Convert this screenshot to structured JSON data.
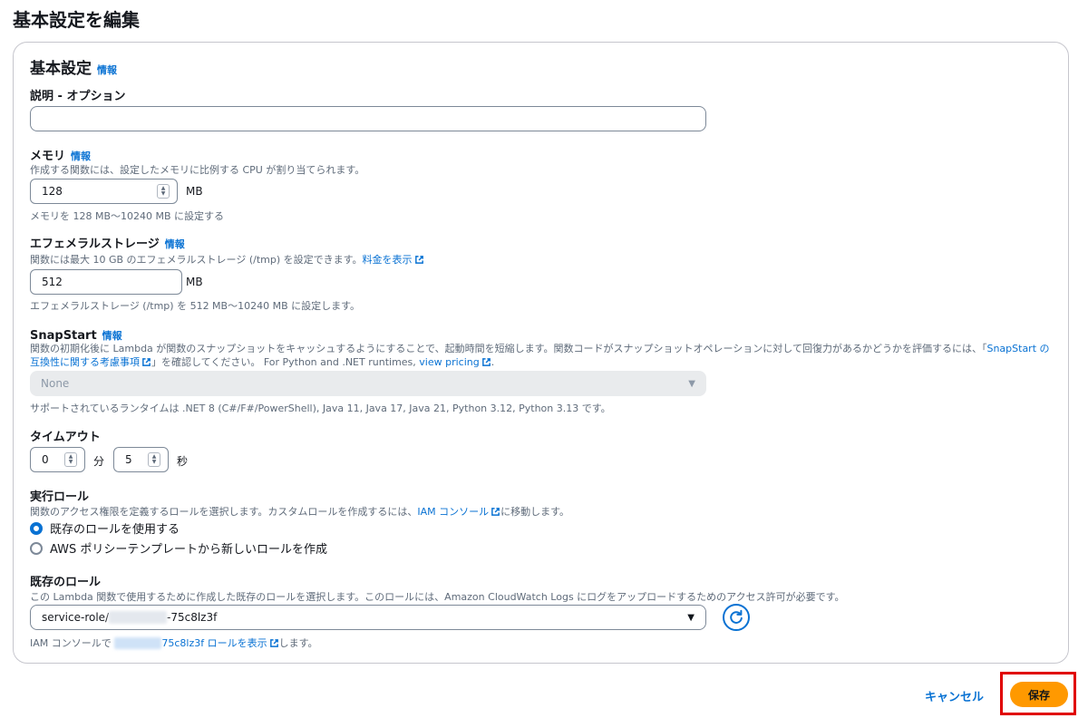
{
  "page": {
    "title": "基本設定を編集"
  },
  "section": {
    "title": "基本設定",
    "info": "情報"
  },
  "description": {
    "label": "説明 - オプション",
    "value": ""
  },
  "memory": {
    "label": "メモリ",
    "info": "情報",
    "desc": "作成する関数には、設定したメモリに比例する CPU が割り当てられます。",
    "value": "128",
    "unit": "MB",
    "hint": "メモリを 128 MB～10240 MB に設定する"
  },
  "storage": {
    "label": "エフェメラルストレージ",
    "info": "情報",
    "desc": "関数には最大 10 GB のエフェメラルストレージ (/tmp) を設定できます。",
    "link": "料金を表示",
    "value": "512",
    "unit": "MB",
    "hint": "エフェメラルストレージ (/tmp) を 512 MB～10240 MB に設定します。"
  },
  "snapstart": {
    "label": "SnapStart",
    "info": "情報",
    "desc1": "関数の初期化後に Lambda が関数のスナップショットをキャッシュするようにすることで、起動時間を短縮します。関数コードがスナップショットオペレーションに対して回復力があるかどうかを評価するには、「",
    "link1a": "SnapStart の",
    "link1b": "互換性に関する考慮事項",
    "desc2": "」を確認してください。 For Python and .NET runtimes,",
    "link2": "view pricing",
    "desc2_end": ".",
    "select_value": "None",
    "hint": "サポートされているランタイムは .NET 8 (C#/F#/PowerShell), Java 11, Java 17, Java 21, Python 3.12, Python 3.13 です。"
  },
  "timeout": {
    "label": "タイムアウト",
    "minutes": "0",
    "minutes_unit": "分",
    "seconds": "5",
    "seconds_unit": "秒"
  },
  "role": {
    "label": "実行ロール",
    "desc": "関数のアクセス権限を定義するロールを選択します。カスタムロールを作成するには、",
    "link": "IAM コンソール",
    "desc_end": "に移動します。",
    "option1": "既存のロールを使用する",
    "option2": "AWS ポリシーテンプレートから新しいロールを作成"
  },
  "existing_role": {
    "label": "既存のロール",
    "desc": "この Lambda 関数で使用するために作成した既存のロールを選択します。このロールには、Amazon CloudWatch Logs にログをアップロードするためのアクセス許可が必要です。",
    "value_prefix": "service-role/",
    "value_suffix": "-75c8lz3f",
    "hint_prefix": "IAM コンソールで",
    "hint_link": "75c8lz3f ロールを表示",
    "hint_suffix": "します。"
  },
  "footer": {
    "cancel": "キャンセル",
    "save": "保存"
  },
  "colors": {
    "accent": "#0972d3",
    "primary": "#ff9900",
    "highlight": "#e00000"
  }
}
